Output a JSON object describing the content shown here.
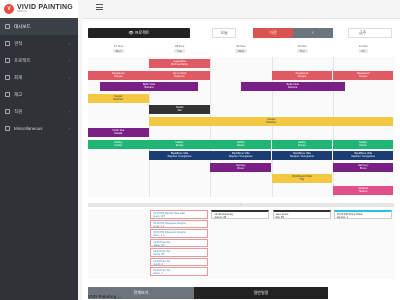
{
  "brand": {
    "name": "VIVID PAINTING",
    "tagline": "DESIGN"
  },
  "sidebar": {
    "items": [
      {
        "label": "대시보드",
        "icon": "dashboard-icon",
        "active": true,
        "has_children": false
      },
      {
        "label": "견적",
        "icon": "estimate-icon",
        "active": false,
        "has_children": true
      },
      {
        "label": "프로젝트",
        "icon": "project-icon",
        "active": false,
        "has_children": true
      },
      {
        "label": "회계",
        "icon": "accounting-icon",
        "active": false,
        "has_children": true
      },
      {
        "label": "재고",
        "icon": "inventory-icon",
        "active": false,
        "has_children": false
      },
      {
        "label": "직원",
        "icon": "staff-icon",
        "active": false,
        "has_children": true
      },
      {
        "label": "Miscellaneous",
        "icon": "misc-icon",
        "active": false,
        "has_children": true
      }
    ]
  },
  "toolbar": {
    "eye_label": "👁 프로젝트",
    "today_label": "오늘",
    "prev_label": "이전",
    "next_label": "‹",
    "week_label": "금주"
  },
  "days": [
    {
      "date": "07 Dec",
      "dow": "Mon"
    },
    {
      "date": "08 Dec",
      "dow": "Tue"
    },
    {
      "date": "09 Dec",
      "dow": "Wed"
    },
    {
      "date": "10 Dec",
      "dow": "Thu"
    },
    {
      "date": "11 Dec",
      "dow": "Fri"
    }
  ],
  "colors": {
    "red": "#e05a63",
    "purple": "#7a1f86",
    "yellow": "#f4c842",
    "green": "#1fb574",
    "navy": "#1c3d73",
    "dark": "#333333",
    "pink": "#e0508a",
    "cyan": "#27c0e0"
  },
  "events": [
    {
      "l1": "Legendaire",
      "l2": "Rich Lamberty",
      "color": "red",
      "row": 0,
      "start": 1.0,
      "span": 1.0
    },
    {
      "l1": "Registered",
      "l2": "Gorges",
      "color": "red",
      "row": 1,
      "start": 0.0,
      "span": 1.0
    },
    {
      "l1": "Jenny Pack",
      "l2": "Daeyeon",
      "color": "red",
      "row": 1,
      "start": 1.0,
      "span": 1.0
    },
    {
      "l1": "Registered",
      "l2": "Gorges",
      "color": "red",
      "row": 1,
      "start": 3.0,
      "span": 1.0
    },
    {
      "l1": "Registered",
      "l2": "Gorges",
      "color": "red",
      "row": 1,
      "start": 4.0,
      "span": 1.0
    },
    {
      "l1": "Bella Vista",
      "l2": "Barbara",
      "color": "purple",
      "row": 2,
      "start": 0.2,
      "span": 1.6
    },
    {
      "l1": "Bella Vista",
      "l2": "Barbara",
      "color": "purple",
      "row": 2,
      "start": 2.5,
      "span": 1.7
    },
    {
      "l1": "Cooper",
      "l2": "Mortimer",
      "color": "yellow",
      "row": 3,
      "start": 0.0,
      "span": 1.0
    },
    {
      "l1": "Tardell",
      "l2": "Rai",
      "color": "dark",
      "row": 4,
      "start": 1.0,
      "span": 1.0
    },
    {
      "l1": "Cooper",
      "l2": "Mortimer",
      "color": "yellow",
      "row": 5,
      "start": 1.0,
      "span": 4.0
    },
    {
      "l1": "North Sea",
      "l2": "Natalia",
      "color": "purple",
      "row": 6,
      "start": 0.0,
      "span": 1.0
    },
    {
      "l1": "Hadley",
      "l2": "Dorian",
      "color": "green",
      "row": 7,
      "start": 0.0,
      "span": 1.0
    },
    {
      "l1": "Hadley",
      "l2": "Dorian",
      "color": "green",
      "row": 7,
      "start": 1.0,
      "span": 1.0
    },
    {
      "l1": "Hadley",
      "l2": "Dorian",
      "color": "green",
      "row": 7,
      "start": 2.0,
      "span": 1.0
    },
    {
      "l1": "Hadley",
      "l2": "Dorian",
      "color": "green",
      "row": 7,
      "start": 3.0,
      "span": 1.0
    },
    {
      "l1": "Hadley",
      "l2": "Dorian",
      "color": "green",
      "row": 7,
      "start": 4.0,
      "span": 1.0
    },
    {
      "l1": "BackBone Villa",
      "l2": "Stephen Youngstone",
      "color": "navy",
      "row": 8,
      "start": 1.0,
      "span": 1.0
    },
    {
      "l1": "BackBone Villa",
      "l2": "Stephen Youngstone",
      "color": "navy",
      "row": 8,
      "start": 2.0,
      "span": 1.0
    },
    {
      "l1": "BackBone Villa",
      "l2": "Stephen Youngstone",
      "color": "navy",
      "row": 8,
      "start": 3.0,
      "span": 1.0
    },
    {
      "l1": "BackBone Villa",
      "l2": "Stephen Youngstone",
      "color": "navy",
      "row": 8,
      "start": 4.0,
      "span": 1.0
    },
    {
      "l1": "Hanway",
      "l2": "Bruce",
      "color": "purple",
      "row": 9,
      "start": 2.0,
      "span": 1.0
    },
    {
      "l1": "Harmony",
      "l2": "Bruce",
      "color": "purple",
      "row": 9,
      "start": 4.0,
      "span": 1.0
    },
    {
      "l1": "Wyndhamm Park",
      "l2": "Tilly",
      "color": "yellow",
      "row": 10,
      "start": 3.0,
      "span": 1.0
    },
    {
      "l1": "Kirkland",
      "l2": "Sharon",
      "color": "pink",
      "row": 11,
      "start": 4.0,
      "span": 1.0
    }
  ],
  "splitter_label": "⋯",
  "lower_cards": [
    {
      "title": "15:00 PM Danish Tank Hall",
      "sub": "Huan, 107",
      "col": 1,
      "row": 0,
      "header": ""
    },
    {
      "title": "14:00 Rosemary",
      "sub": "Ajarne, 95",
      "col": 2,
      "row": 0,
      "header": "dark"
    },
    {
      "title": "Jae Lamos",
      "sub": "Rai, 85",
      "col": 3,
      "row": 0,
      "header": "dark"
    },
    {
      "title": "15:00 PM Stone Rhea",
      "sub": "Jacopo, 1",
      "col": 4,
      "row": 0,
      "header": "cyan"
    },
    {
      "title": "10:30 PM Sheppard Heights",
      "sub": "Luna, 1 4",
      "col": 1,
      "row": 1,
      "header": ""
    },
    {
      "title": "15:00 PM Sheppard Heights",
      "sub": "Harry, 1 4",
      "col": 1,
      "row": 2,
      "header": ""
    },
    {
      "title": "14:40 Pure Sis",
      "sub": "Jasan, 92",
      "col": 1,
      "row": 3,
      "header": ""
    },
    {
      "title": "14:50 Pure Sis",
      "sub": "Hema, 85",
      "col": 1,
      "row": 4,
      "header": ""
    },
    {
      "title": "14:00 Pure Sis",
      "sub": "Ayesh, 2",
      "col": 1,
      "row": 5,
      "header": ""
    },
    {
      "title": "15:00 Pure Sis",
      "sub": "Aarav, 7",
      "col": 1,
      "row": 6,
      "header": ""
    }
  ],
  "bottom_buttons": {
    "left_label": "전체보기",
    "right_label": "일반일정"
  },
  "footer_title": "VVD Painting ..."
}
